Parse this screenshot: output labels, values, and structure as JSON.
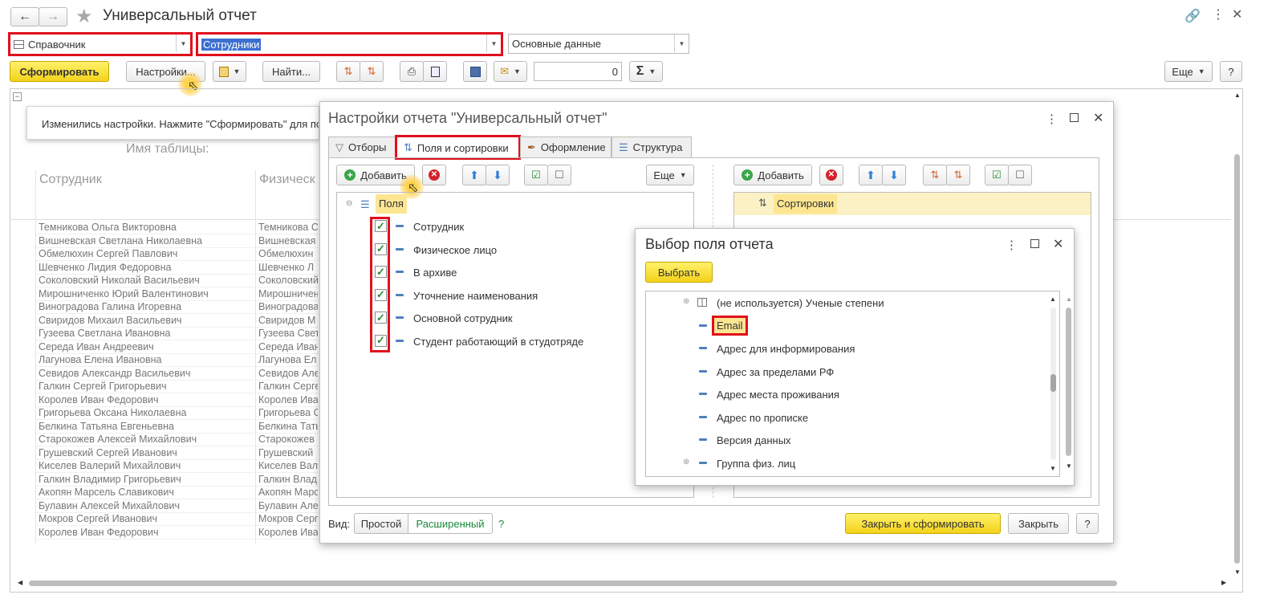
{
  "window": {
    "title": "Универсальный отчет"
  },
  "selectors": {
    "type_value": "Справочник",
    "object_value": "Сотрудники",
    "variant_value": "Основные данные"
  },
  "toolbar": {
    "generate": "Сформировать",
    "settings": "Настройки...",
    "find": "Найти...",
    "counter": "0",
    "sum_symbol": "Σ",
    "more": "Еще",
    "help": "?"
  },
  "notice": {
    "text": "Изменились настройки. Нажмите \"Сформировать\" для пол"
  },
  "report": {
    "table_name_label": "Имя таблицы:",
    "col1": "Сотрудник",
    "col2": "Физическ",
    "rows": [
      [
        "Темникова Ольга Викторовна",
        "Темникова С"
      ],
      [
        "Вишневская Светлана Николаевна",
        "Вишневская"
      ],
      [
        "Обмелюхин Сергей Павлович",
        "Обмелюхин"
      ],
      [
        "Шевченко Лидия Федоровна",
        "Шевченко Л"
      ],
      [
        "Соколовский Николай Васильевич",
        "Соколовский"
      ],
      [
        "Мирошниченко Юрий Валентинович",
        "Мирошничен"
      ],
      [
        "Виноградова Галина Игоревна",
        "Виноградова"
      ],
      [
        "Свиридов Михаил Васильевич",
        "Свиридов М"
      ],
      [
        "Гузеева Светлана Ивановна",
        "Гузеева Свет"
      ],
      [
        "Середа Иван Андреевич",
        "Середа Иван"
      ],
      [
        "Лагунова Елена Ивановна",
        "Лагунова Ел"
      ],
      [
        "Севидов Александр Васильевич",
        "Севидов Але"
      ],
      [
        "Галкин Сергей Григорьевич",
        "Галкин Серге"
      ],
      [
        "Королев Иван Федорович",
        "Королев Ива"
      ],
      [
        "Григорьева Оксана Николаевна",
        "Григорьева С"
      ],
      [
        "Белкина Татьяна Евгеньевна",
        "Белкина Тать"
      ],
      [
        "Старокожев Алексей Михайлович",
        "Старокожев"
      ],
      [
        "Грушевский Сергей Иванович",
        "Грушевский"
      ],
      [
        "Киселев Валерий Михайлович",
        "Киселев Вал"
      ],
      [
        "Галкин Владимир Григорьевич",
        "Галкин Влад"
      ],
      [
        "Акопян Марсель Славикович",
        "Акопян Марс"
      ],
      [
        "Булавин Алексей Михайлович",
        "Булавин Але"
      ],
      [
        "Мокров Сергей Иванович",
        "Мокров Серг"
      ],
      [
        "Королев Иван Федорович",
        "Королев Ива"
      ]
    ]
  },
  "settings_dialog": {
    "title": "Настройки отчета \"Универсальный отчет\"",
    "tabs": [
      "Отборы",
      "Поля и сортировки",
      "Оформление",
      "Структура"
    ],
    "add": "Добавить",
    "more": "Еще",
    "fields_root": "Поля",
    "fields": [
      "Сотрудник",
      "Физическое лицо",
      "В архиве",
      "Уточнение наименования",
      "Основной сотрудник",
      "Студент работающий в студотряде"
    ],
    "sort_root": "Сортировки",
    "view_label": "Вид:",
    "view_simple": "Простой",
    "view_extended": "Расширенный",
    "view_help": "?",
    "close_generate": "Закрыть и сформировать",
    "close": "Закрыть",
    "help": "?"
  },
  "field_dialog": {
    "title": "Выбор поля отчета",
    "select": "Выбрать",
    "items": [
      "(не используется) Ученые степени",
      "Email",
      "Адрес для информирования",
      "Адрес за пределами РФ",
      "Адрес места проживания",
      "Адрес по прописке",
      "Версия данных",
      "Группа физ. лиц"
    ]
  },
  "colors": {
    "accent_yellow": "#f3d21a",
    "highlight_red": "#e0101c",
    "selection_blue": "#3d6fd1",
    "check_green": "#2a8a3a"
  }
}
